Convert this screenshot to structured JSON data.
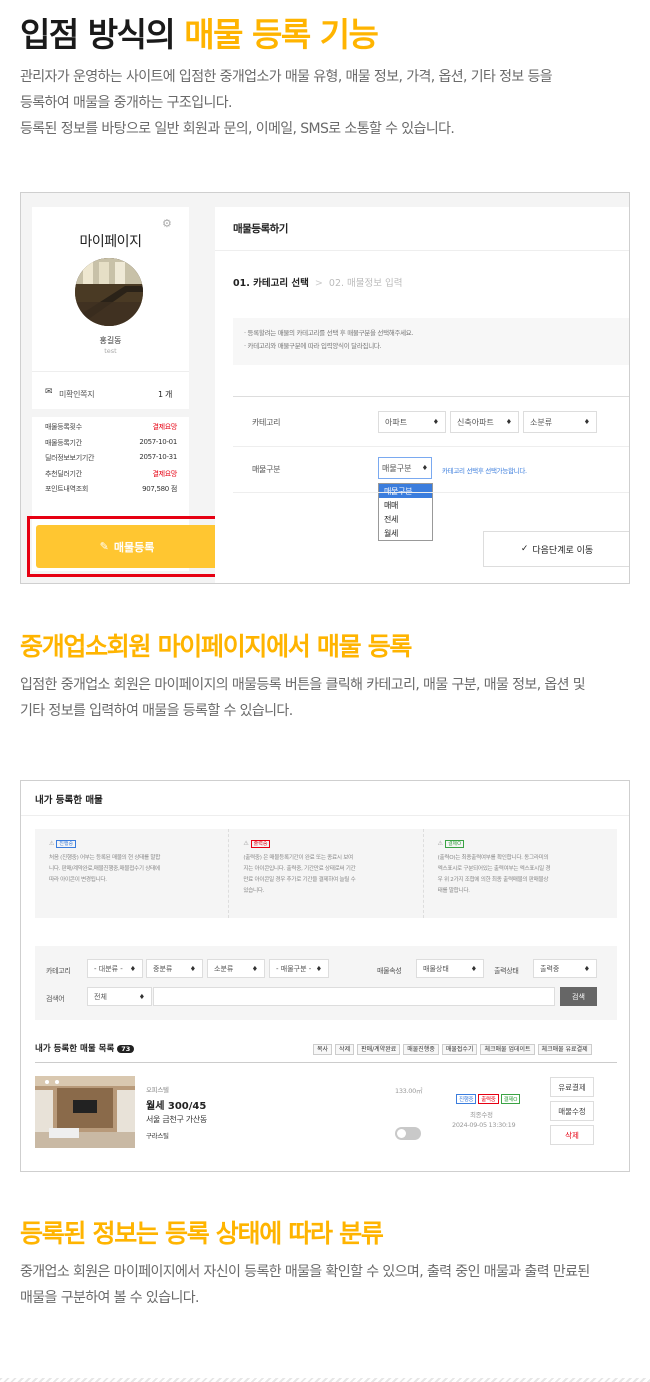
{
  "section1": {
    "title_plain": "입점 방식의 ",
    "title_highlight": "매물 등록 기능",
    "desc_line1": "관리자가 운영하는 사이트에 입점한 중개업소가 매물 유형, 매물 정보, 가격, 옵션, 기타 정보 등을",
    "desc_line2": "등록하여 매물을 중개하는 구조입니다.",
    "desc_line3": "등록된 정보를 바탕으로 일반 회원과 문의, 이메일, SMS로 소통할 수 있습니다."
  },
  "mypage": {
    "title": "마이페이지",
    "name": "홍길동",
    "id": "test",
    "unread_label": "미확인쪽지",
    "unread_count": "1 개",
    "stats": [
      {
        "label": "매물등록횟수",
        "value": "결제요망",
        "red": true
      },
      {
        "label": "매물등록기간",
        "value": "2057-10-01",
        "red": false
      },
      {
        "label": "딜러정보보기기간",
        "value": "2057-10-31",
        "red": false
      },
      {
        "label": "추천딜러기간",
        "value": "결제요망",
        "red": true
      },
      {
        "label": "포인트내역조회",
        "value": "907,580 점",
        "red": false
      }
    ],
    "register_button": "매물등록"
  },
  "form": {
    "title": "매물등록하기",
    "step1": "01. 카테고리 선택",
    "step_sep": ">",
    "step2": "02. 매물정보 입력",
    "note1": "· 등록할려는 매물의 카테고리를 선택 후 매물구분을 선택해주세요.",
    "note2": "· 카테고리와 매물구분에 따라 입력양식이 달라집니다.",
    "category_label": "카테고리",
    "category_values": [
      "아파트",
      "신축아파트",
      "소분류"
    ],
    "type_label": "매물구분",
    "type_value": "매물구분",
    "type_hint": "카테고리 선택후 선택가능합니다.",
    "type_options": [
      "매물구분",
      "매매",
      "전세",
      "월세"
    ],
    "next_button": "다음단계로 이동"
  },
  "section2": {
    "title": "중개업소회원 마이페이지에서 매물 등록",
    "desc_line1": "입점한 중개업소 회원은 마이페이지의 매물등록 버튼을 클릭해 카테고리, 매물 구분, 매물 정보, 옵션 및",
    "desc_line2": "기타 정보를 입력하여 매물을 등록할 수 있습니다."
  },
  "mylist": {
    "title": "내가 등록한 매물",
    "info": [
      {
        "badge": "진행중",
        "lines": [
          "처음 (진행중) 어부는 등록된 매물의 현 상태를 말합",
          "니다. 판매/계약완료,매물진행중,매물접수기 상태에",
          "따라 아이콘이 변경됩니다."
        ]
      },
      {
        "badge": "출력중",
        "lines": [
          "(출력중) 은 매물등록기간이 완료 또는 종료시 보여",
          "지는 아이콘입니다. 출력중, 기간만료 상태로써 기간",
          "만료 아이콘일 경우 추가로 기간을 결제하여 늘릴 수",
          "있습니다."
        ]
      },
      {
        "badge": "결제O",
        "lines": [
          "(출력O)는 최종출력여부를 확인합니다. 동그라미의",
          "엑스표시로 구분되어있는 출력여부는 엑스표시일 경",
          "우 위 2가지 조합에 의한 최종 출력매물의 판매물상",
          "태를 말합니다."
        ]
      }
    ],
    "filters": {
      "category_label": "카테고리",
      "cat1": "- 대분류 -",
      "cat2": "중분류",
      "cat3": "소분류",
      "type": "- 매물구분 -",
      "attr_label": "매물속성",
      "attr": "매물상태",
      "out_label": "출력상태",
      "out": "출력중",
      "search_label": "검색어",
      "search_scope": "전체",
      "search_button": "검색"
    },
    "list_title": "내가 등록한 매물 목록",
    "list_count": "73",
    "actions": [
      "복사",
      "삭제",
      "판매/계약완료",
      "매물진행중",
      "매물접수기",
      "체크매물 업데이트",
      "체크매물 유료결제"
    ],
    "item": {
      "category": "오피스텔",
      "price": "월세 300/45",
      "address": "서울 금천구 가산동",
      "agency": "구라스틸",
      "area": "133.00㎡",
      "badges": [
        "진행중",
        "출력중",
        "결제O"
      ],
      "status_text": "최종수정",
      "date": "2024-09-05 13:30:19",
      "buttons": [
        "유료결제",
        "매물수정",
        "삭제"
      ]
    }
  },
  "section3": {
    "title": "등록된 정보는 등록 상태에 따라 분류",
    "desc_line1": "중개업소 회원은 마이페이지에서 자신이 등록한 매물을 확인할 수 있으며, 출력 중인 매물과 출력 만료된",
    "desc_line2": "매물을 구분하여 볼 수 있습니다."
  },
  "colors": {
    "accent": "#ffb400",
    "button_yellow": "#ffc631",
    "highlight_red": "#e60012",
    "dropdown_blue": "#3b7ddd"
  }
}
